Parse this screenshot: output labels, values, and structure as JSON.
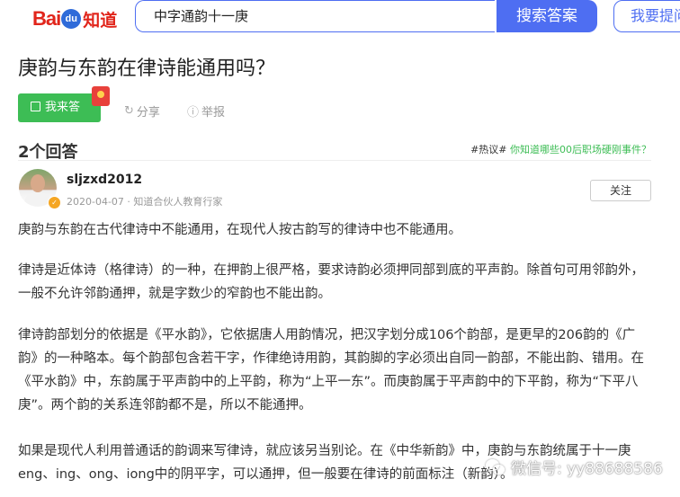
{
  "header": {
    "logo_bai": "Bai",
    "logo_du": "du",
    "logo_zhidao": "知道",
    "search_value": "中字通韵十一庚",
    "search_button": "搜索答案",
    "ask_button": "我要提问"
  },
  "question": {
    "title": "庚韵与东韵在律诗能通用吗？",
    "answer_button": "我来答",
    "share_label": "分享",
    "report_label": "举报"
  },
  "answers_section": {
    "count_label": "2个回答",
    "hot_tag": "#热议#",
    "hot_link": "你知道哪些00后职场硬刚事件？"
  },
  "answer": {
    "username": "sljzxd2012",
    "meta": "2020-04-07 · 知道合伙人教育行家",
    "follow_button": "关注",
    "paragraphs": [
      "庚韵与东韵在古代律诗中不能通用，在现代人按古韵写的律诗中也不能通用。",
      "律诗是近体诗（格律诗）的一种，在押韵上很严格，要求诗韵必须押同部到底的平声韵。除首句可用邻韵外，一般不允许邻韵通押，就是字数少的窄韵也不能出韵。",
      "律诗韵部划分的依据是《平水韵》，它依据唐人用韵情况，把汉字划分成106个韵部，是更早的206韵的《广韵》的一种略本。每个韵部包含若干字，作律绝诗用韵，其韵脚的字必须出自同一韵部，不能出韵、错用。在《平水韵》中，东韵属于平声韵中的上平韵，称为“上平一东”。而庚韵属于平声韵中的下平韵，称为“下平八庚”。两个韵的关系连邻韵都不是，所以不能通押。",
      "如果是现代人利用普通话的韵调来写律诗，就应该另当别论。在《中华新韵》中，庚韵与东韵统属于十一庚 eng、ing、ong、iong中的阴平字，可以通押，但一般要在律诗的前面标注（新韵）。"
    ]
  },
  "watermark": {
    "text": "微信号: yy88688586"
  }
}
